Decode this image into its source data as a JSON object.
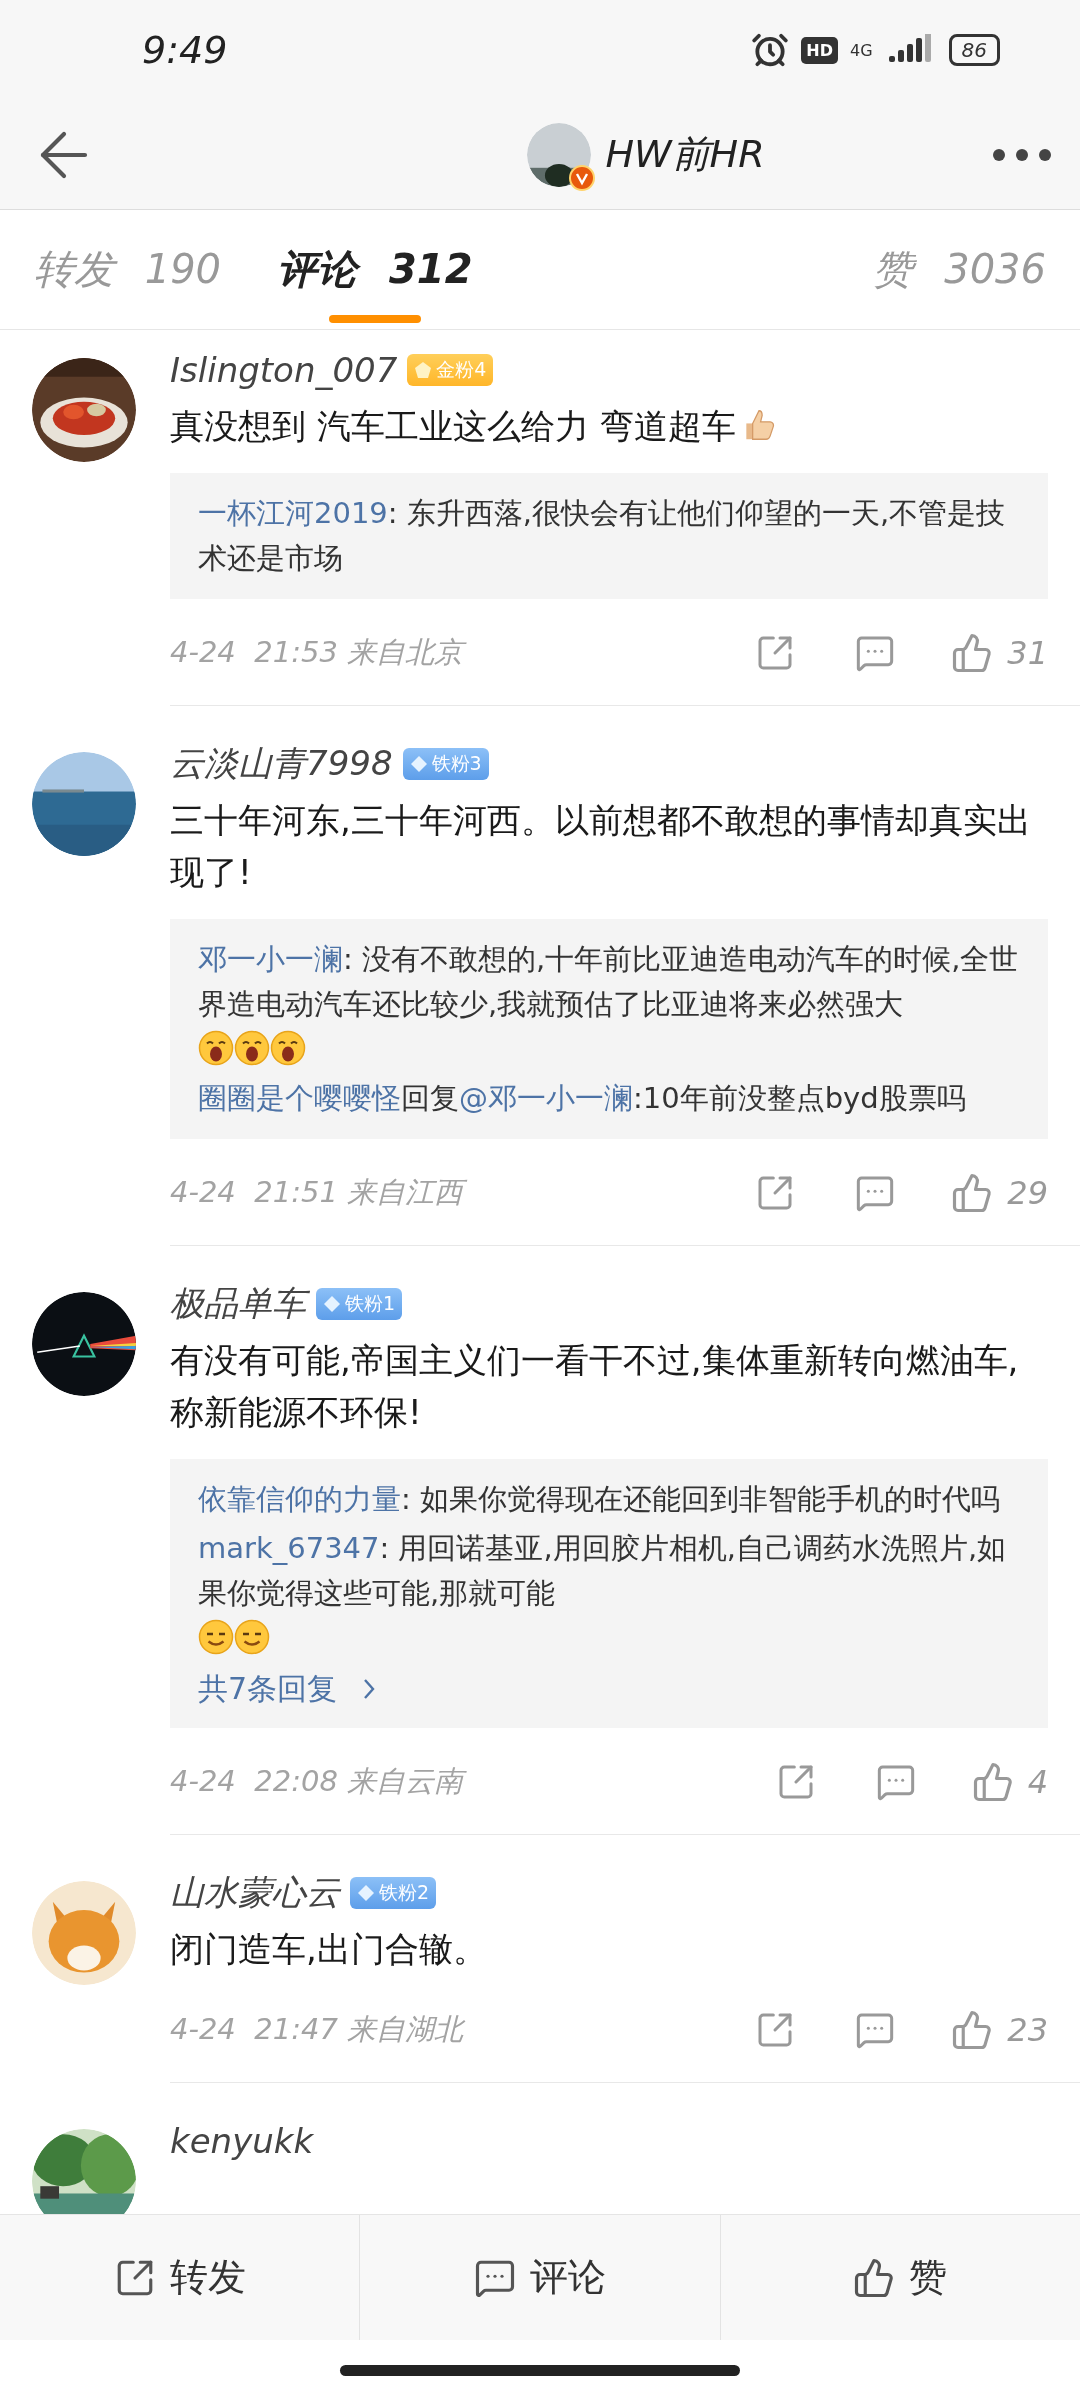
{
  "status_bar": {
    "time": "9:49",
    "hd": "HD",
    "network": "4G",
    "battery": "86"
  },
  "header": {
    "title": "HW前HR",
    "verified": true
  },
  "tabs": [
    {
      "label": "转发",
      "count": "190",
      "selected": false
    },
    {
      "label": "评论",
      "count": "312",
      "selected": true
    },
    {
      "label": "赞",
      "count": "3036",
      "selected": false
    }
  ],
  "comments": [
    {
      "user": "Islington_007",
      "badge": {
        "kind": "gold",
        "label": "金粉4"
      },
      "text": "真没想到 汽车工业这么给力 弯道超车",
      "emojis": [
        {
          "kind": "thumbs"
        }
      ],
      "replies": [
        {
          "author": "一杯江河2019",
          "text": ": 东升西落,很快会有让他们仰望的一天,不管是技术还是市场"
        }
      ],
      "meta": "4-24  21:53 来自北京",
      "likes": "31"
    },
    {
      "user": "云淡山青7998",
      "badge": {
        "kind": "iron",
        "label": "铁粉3"
      },
      "text": "三十年河东,三十年河西。以前想都不敢想的事情却真实出现了!",
      "replies": [
        {
          "author": "邓一小一澜",
          "text": ": 没有不敢想的,十年前比亚迪造电动汽车的时候,全世界造电动汽车还比较少,我就预估了比亚迪将来必然强大",
          "emojis": [
            {
              "kind": "yawn"
            },
            {
              "kind": "yawn"
            },
            {
              "kind": "yawn"
            }
          ]
        },
        {
          "author": "圈圈是个嘤嘤怪",
          "reply_word": "回复",
          "mention": "@邓一小一澜",
          "text": ":10年前没整点byd股票吗"
        }
      ],
      "meta": "4-24  21:51 来自江西",
      "likes": "29"
    },
    {
      "user": "极品单车",
      "badge": {
        "kind": "iron",
        "label": "铁粉1"
      },
      "text": "有没有可能,帝国主义们一看干不过,集体重新转向燃油车,称新能源不环保!",
      "replies": [
        {
          "author": "依靠信仰的力量",
          "text": ": 如果你觉得现在还能回到非智能手机的时代吗"
        },
        {
          "author": "mark_67347",
          "text": ": 用回诺基亚,用回胶片相机,自己调药水洗照片,如果你觉得这些可能,那就可能",
          "emojis": [
            {
              "kind": "smug"
            },
            {
              "kind": "smug"
            }
          ]
        }
      ],
      "more": "共7条回复",
      "meta": "4-24  22:08 来自云南",
      "likes": "4"
    },
    {
      "user": "山水蒙心云",
      "badge": {
        "kind": "iron",
        "label": "铁粉2"
      },
      "text": "闭门造车,出门合辙。",
      "meta": "4-24  21:47 来自湖北",
      "likes": "23"
    },
    {
      "user": "kenyukk"
    }
  ],
  "bottom_bar": [
    {
      "kind": "share",
      "label": "转发"
    },
    {
      "kind": "comment",
      "label": "评论"
    },
    {
      "kind": "like",
      "label": "赞"
    }
  ]
}
